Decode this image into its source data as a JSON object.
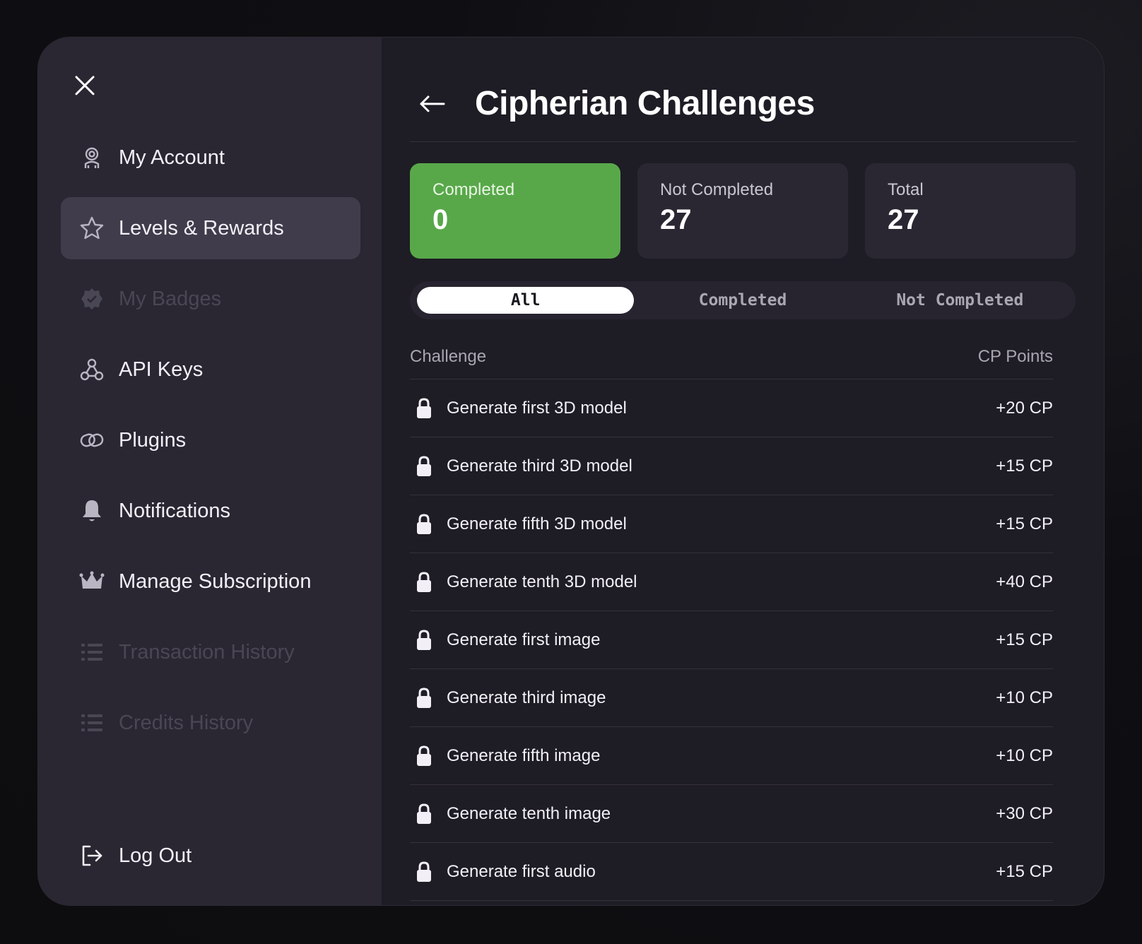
{
  "sidebar": {
    "items": [
      {
        "label": "My Account",
        "icon": "user-icon",
        "state": "normal"
      },
      {
        "label": "Levels & Rewards",
        "icon": "star-icon",
        "state": "active"
      },
      {
        "label": "My Badges",
        "icon": "badge-icon",
        "state": "disabled"
      },
      {
        "label": "API Keys",
        "icon": "webhook-icon",
        "state": "normal"
      },
      {
        "label": "Plugins",
        "icon": "link-icon",
        "state": "normal"
      },
      {
        "label": "Notifications",
        "icon": "bell-icon",
        "state": "normal"
      },
      {
        "label": "Manage Subscription",
        "icon": "crown-icon",
        "state": "normal"
      },
      {
        "label": "Transaction History",
        "icon": "list-icon",
        "state": "disabled"
      },
      {
        "label": "Credits History",
        "icon": "list-icon",
        "state": "disabled"
      }
    ],
    "logout_label": "Log Out"
  },
  "header": {
    "title": "Cipherian Challenges"
  },
  "stats": [
    {
      "label": "Completed",
      "value": "0",
      "color": "#58a84a"
    },
    {
      "label": "Not Completed",
      "value": "27"
    },
    {
      "label": "Total",
      "value": "27"
    }
  ],
  "tabs": [
    {
      "label": "All",
      "active": true
    },
    {
      "label": "Completed",
      "active": false
    },
    {
      "label": "Not Completed",
      "active": false
    }
  ],
  "table": {
    "col_challenge": "Challenge",
    "col_points": "CP Points",
    "rows": [
      {
        "name": "Generate first 3D model",
        "points": "+20 CP"
      },
      {
        "name": "Generate third 3D model",
        "points": "+15 CP"
      },
      {
        "name": "Generate fifth 3D model",
        "points": "+15 CP"
      },
      {
        "name": "Generate tenth 3D model",
        "points": "+40 CP"
      },
      {
        "name": "Generate first image",
        "points": "+15 CP"
      },
      {
        "name": "Generate third image",
        "points": "+10 CP"
      },
      {
        "name": "Generate fifth image",
        "points": "+10 CP"
      },
      {
        "name": "Generate tenth image",
        "points": "+30 CP"
      },
      {
        "name": "Generate first audio",
        "points": "+15 CP"
      }
    ]
  },
  "colors": {
    "accent_green": "#58a84a",
    "sidebar_bg": "#2a2733",
    "panel_bg": "#1e1c24",
    "active_item_bg": "#403c4b"
  }
}
